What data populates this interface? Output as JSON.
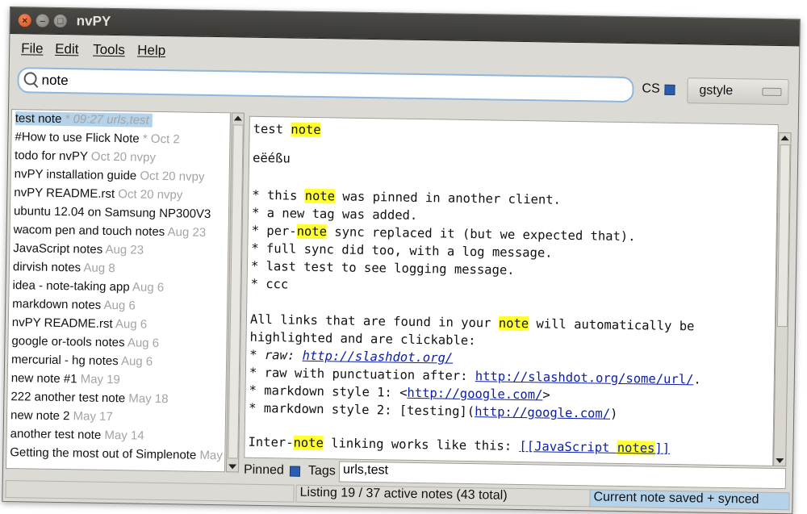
{
  "window": {
    "title": "nvPY"
  },
  "menu": {
    "file": "File",
    "edit": "Edit",
    "tools": "Tools",
    "help": "Help"
  },
  "search": {
    "value": "note"
  },
  "cs": {
    "label": "CS"
  },
  "style_select": {
    "value": "gstyle"
  },
  "notes": [
    {
      "title": "test note",
      "meta": " * 09:27 urls,test"
    },
    {
      "title": "#How to use Flick Note",
      "meta": " * Oct 2"
    },
    {
      "title": "todo for nvPY",
      "meta": " Oct 20 nvpy"
    },
    {
      "title": "nvPY installation guide",
      "meta": " Oct 20 nvpy"
    },
    {
      "title": "nvPY README.rst",
      "meta": " Oct 20 nvpy"
    },
    {
      "title": "ubuntu 12.04 on Samsung NP300V3",
      "meta": ""
    },
    {
      "title": "wacom pen and touch notes",
      "meta": " Aug 23"
    },
    {
      "title": "JavaScript notes",
      "meta": " Aug 23"
    },
    {
      "title": "dirvish notes",
      "meta": " Aug 8"
    },
    {
      "title": "idea - note-taking app",
      "meta": " Aug 6"
    },
    {
      "title": "markdown notes",
      "meta": " Aug 6"
    },
    {
      "title": "nvPY README.rst",
      "meta": " Aug 6"
    },
    {
      "title": "google or-tools notes",
      "meta": " Aug 6"
    },
    {
      "title": "mercurial - hg notes",
      "meta": " Aug 6"
    },
    {
      "title": "new note #1",
      "meta": " May 19"
    },
    {
      "title": "222 another test note",
      "meta": " May 18"
    },
    {
      "title": "new note 2",
      "meta": " May 17"
    },
    {
      "title": "another test note",
      "meta": " May 14"
    },
    {
      "title": "Getting the most out of Simplenote",
      "meta": " May"
    }
  ],
  "editor": {
    "l1a": "test ",
    "l1b": "note",
    "l2": "eëéßu",
    "l3a": "* this ",
    "l3b": "note",
    "l3c": " was pinned in another client.",
    "l4": "* a new tag was added.",
    "l5a": "* per-",
    "l5b": "note",
    "l5c": " sync replaced it (but we expected that).",
    "l6": "* full sync did too, with a log message.",
    "l7": "* last test to see logging message.",
    "l8": "* ccc",
    "l9a": "All links that are found in your ",
    "l9b": "note",
    "l9c": " will automatically be",
    "l10": "highlighted and are clickable:",
    "l11a": "* raw: ",
    "l11b": "http://slashdot.org/",
    "l12a": "* raw with punctuation after: ",
    "l12b": "http://slashdot.org/some/url/",
    "l12c": ".",
    "l13a": "* markdown style 1: <",
    "l13b": "http://google.com/",
    "l13c": ">",
    "l14a": "* markdown style 2: [testing](",
    "l14b": "http://google.com/",
    "l14c": ")",
    "l15a": "Inter-",
    "l15b": "note",
    "l15c": " linking works like this: ",
    "l15d": "[[JavaScript ",
    "l15e": "notes",
    "l15f": "]]"
  },
  "bottom": {
    "pinned_label": "Pinned",
    "tags_label": "Tags",
    "tags_value": "urls,test"
  },
  "status": {
    "listing": "Listing 19 / 37 active notes (43 total)",
    "sync": "Current note saved + synced"
  },
  "colors": {
    "highlight": "#ffff33",
    "selection": "#b4d2ea",
    "link": "#0a1ea8"
  }
}
